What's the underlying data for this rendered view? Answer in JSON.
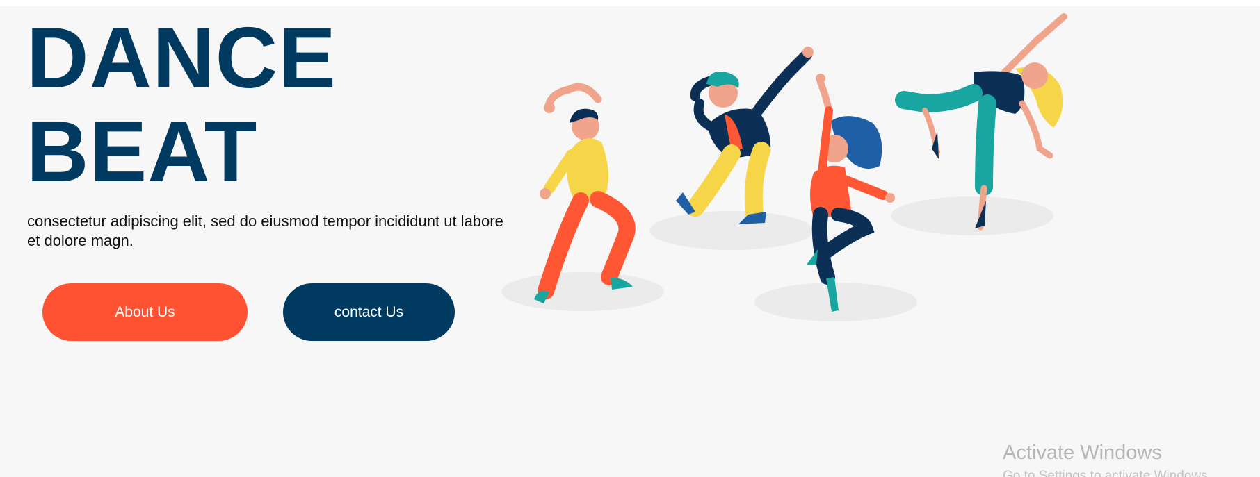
{
  "hero": {
    "title_line1": "DANCE",
    "title_line2": "BEAT",
    "description": "consectetur adipiscing elit, sed do eiusmod tempor incididunt ut labore et dolore magn."
  },
  "buttons": {
    "about": "About Us",
    "contact": "contact Us"
  },
  "illustration": {
    "icon": "dancers-illustration"
  },
  "watermark": {
    "title": "Activate Windows",
    "subtitle": "Go to Settings to activate Windows."
  },
  "colors": {
    "primary": "#003a61",
    "accent": "#ff5233",
    "background": "#f7f7f7"
  }
}
